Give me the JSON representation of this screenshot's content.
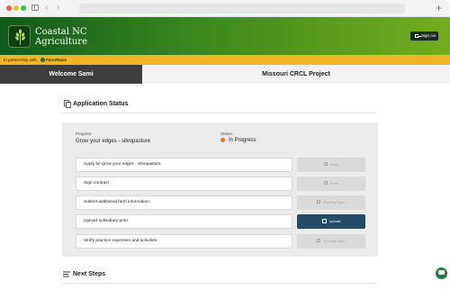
{
  "browser": {
    "back_icon": "‹",
    "forward_icon": "›",
    "new_tab_icon": "+"
  },
  "header": {
    "brand_line1": "Coastal NC",
    "brand_line2": "Agriculture",
    "signout_label": "Sign out",
    "gradient_start": "#0f5a1d",
    "gradient_end": "#75ac1e"
  },
  "partner_bar": {
    "text": "In partnership with",
    "partner_name": "FarmRaise",
    "color": "#f3b325"
  },
  "tabs": [
    {
      "label": "Welcome Sami",
      "active": true
    },
    {
      "label": "Missouri CRCL Project",
      "active": false
    }
  ],
  "application_status": {
    "title": "Application Status",
    "program_label": "Program:",
    "program_value": "Grow your edges - silvopasture",
    "status_label": "Status:",
    "status_value": "In Progress",
    "status_color": "#e8751a",
    "tasks": [
      {
        "label": "Apply for grow your edges - silvopasture",
        "action": "Done",
        "action_state": "disabled"
      },
      {
        "label": "Sign contract",
        "action": "Done",
        "action_state": "disabled"
      },
      {
        "label": "Submit additional farm information",
        "action": "Coming Soon",
        "action_state": "disabled"
      },
      {
        "label": "Upload subsidiary print",
        "action": "Upload",
        "action_state": "primary"
      },
      {
        "label": "Verify practice expenses and activities",
        "action": "Coming Soon",
        "action_state": "disabled"
      }
    ]
  },
  "next_steps": {
    "title": "Next Steps"
  },
  "icons": {
    "documents": "documents-icon",
    "list": "list-icon",
    "chat": "chat-icon"
  }
}
